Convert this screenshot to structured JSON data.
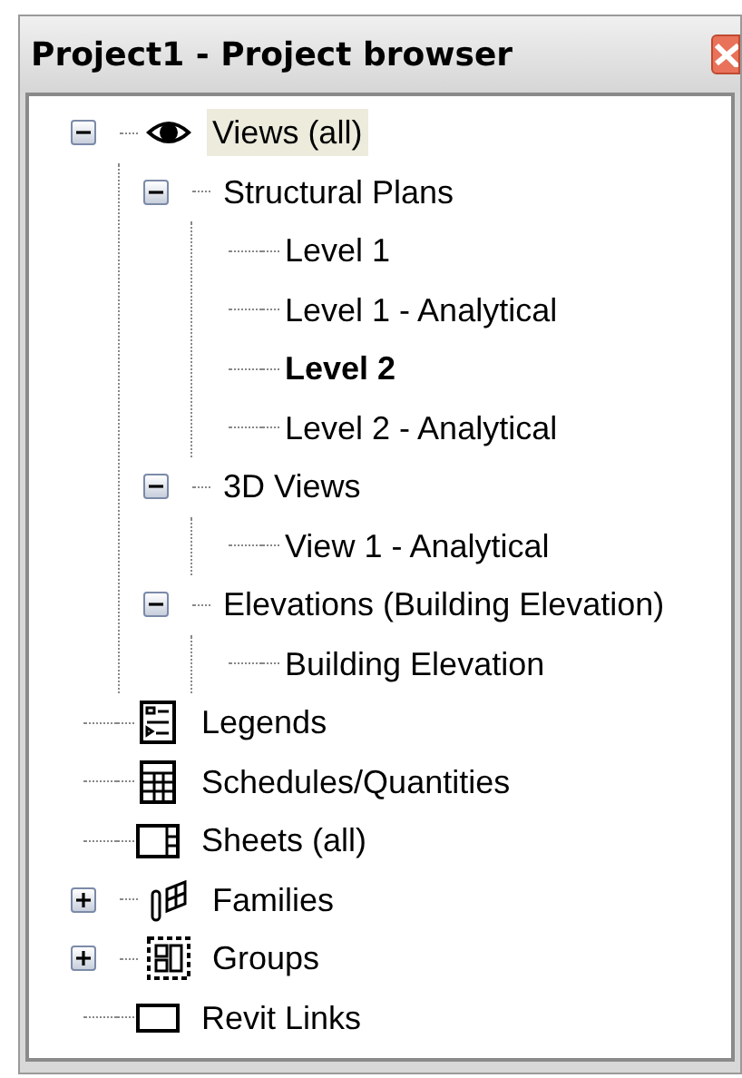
{
  "window": {
    "title": "Project1 - Project browser"
  },
  "tree": [
    {
      "label": "Views (all)",
      "kind": "eye",
      "expanded": true,
      "selected": true,
      "current": false,
      "children": [
        {
          "label": "Structural Plans",
          "expanded": true,
          "selected": false,
          "current": false,
          "children": [
            {
              "label": "Level 1",
              "selected": false,
              "current": false
            },
            {
              "label": "Level 1 - Analytical",
              "selected": false,
              "current": false
            },
            {
              "label": "Level 2",
              "selected": false,
              "current": true
            },
            {
              "label": "Level 2 - Analytical",
              "selected": false,
              "current": false
            }
          ]
        },
        {
          "label": "3D Views",
          "expanded": true,
          "selected": false,
          "current": false,
          "children": [
            {
              "label": "View 1 - Analytical",
              "selected": false,
              "current": false
            }
          ]
        },
        {
          "label": "Elevations (Building Elevation)",
          "expanded": true,
          "selected": false,
          "current": false,
          "children": [
            {
              "label": "Building Elevation",
              "selected": false,
              "current": false
            }
          ]
        }
      ]
    },
    {
      "label": "Legends",
      "kind": "legend",
      "selected": false,
      "current": false
    },
    {
      "label": "Schedules/Quantities",
      "kind": "schedule",
      "selected": false,
      "current": false
    },
    {
      "label": "Sheets (all)",
      "kind": "sheet",
      "selected": false,
      "current": false
    },
    {
      "label": "Families",
      "kind": "families",
      "expanded": false,
      "selected": false,
      "current": false
    },
    {
      "label": "Groups",
      "kind": "groups",
      "expanded": false,
      "selected": false,
      "current": false
    },
    {
      "label": "Revit Links",
      "kind": "links",
      "selected": false,
      "current": false
    }
  ]
}
